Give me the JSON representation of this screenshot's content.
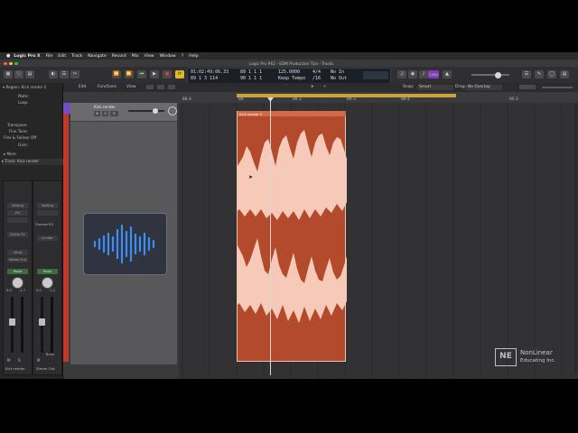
{
  "menubar": {
    "apple": "",
    "app": "Logic Pro X",
    "items": [
      "File",
      "Edit",
      "Track",
      "Navigate",
      "Record",
      "Mix",
      "View",
      "Window",
      "?",
      "Help"
    ]
  },
  "window": {
    "title": "Logic Pro #62 - EDM Production Tips - Tracks"
  },
  "control_bar": {
    "buttons": [
      "library",
      "inspector",
      "toolbar",
      "smart-controls",
      "mixer",
      "editors"
    ],
    "transport": [
      "⏪",
      "⏩",
      "⏮",
      "▶",
      "●",
      "⟳"
    ],
    "lcd": {
      "smpte": "01:02:49:06.33",
      "bars_top": "89  1  1     1",
      "bars_bottom": "89  1  3  114",
      "bars2_bottom": "90  1  1     1",
      "tempo": "125.0000",
      "tempo_label": "Keep Tempo",
      "sig_top": "4/4",
      "sig_bottom": "/16",
      "in": "No In",
      "out": "No Out"
    },
    "cpu_badge": "1234"
  },
  "inspector": {
    "region_label": "Region: Kick render 2",
    "rows": [
      "Mute:",
      "Loop:",
      "Transpose:",
      "Fine Tune:",
      "Flex & Follow: Off",
      "Gain:",
      "More"
    ],
    "track_label": "Track: Kick render"
  },
  "channel_strips": [
    {
      "name": "Kick render",
      "setting": "Setting",
      "eq": "EQ",
      "input": "",
      "audio_fx": "Audio FX",
      "send": "Send",
      "output": "Stereo Out",
      "read": "Read",
      "vol": "0.0",
      "pan": "-1.7",
      "m": "M",
      "s": "S",
      "level": 0.55
    },
    {
      "name": "Stereo Out",
      "setting": "Setting",
      "eq": "Channel EQ",
      "input": "",
      "audio_fx": "Limiter",
      "send": "",
      "output": "",
      "read": "Read",
      "vol": "0.0",
      "pan": "-2.2",
      "m": "M",
      "s": "Bnce",
      "level": 0.55
    }
  ],
  "tracks_header": {
    "edit": "Edit",
    "functions": "Functions",
    "view": "View",
    "snap_label": "Snap:",
    "snap_value": "Smart",
    "drag_label": "Drag:",
    "drag_value": "No Overlap",
    "track_name": "Kick render",
    "m": "M",
    "s": "S",
    "r": "R"
  },
  "ruler": {
    "labels": [
      "88.4",
      "89",
      "89.2",
      "89.3",
      "89.4",
      "90.3"
    ]
  },
  "region": {
    "name": "Kick render 2"
  },
  "watermark": {
    "line1": "NonLinear",
    "line2": "Educating Inc."
  },
  "colors": {
    "region_fill": "#b24a2b",
    "waveform": "#f6c9b8",
    "cycle": "#c9a33b",
    "track_color": "#c0392b"
  }
}
